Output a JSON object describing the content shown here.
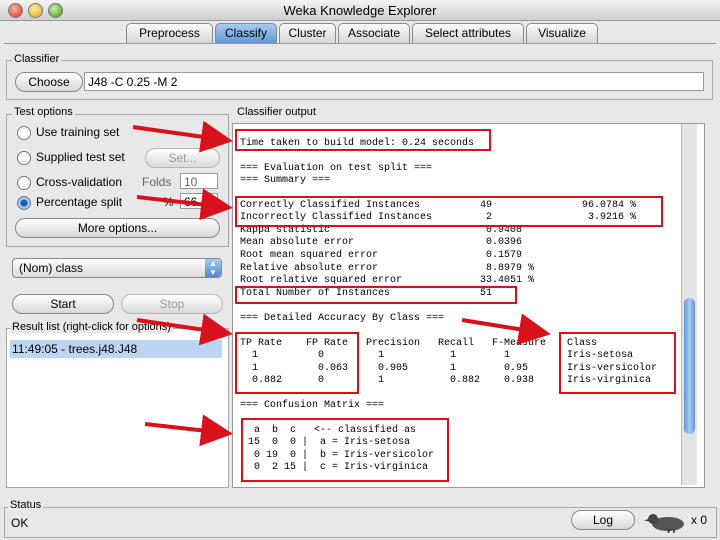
{
  "window": {
    "title": "Weka Knowledge Explorer"
  },
  "tabs": [
    "Preprocess",
    "Classify",
    "Cluster",
    "Associate",
    "Select attributes",
    "Visualize"
  ],
  "classifier": {
    "group_label": "Classifier",
    "choose_label": "Choose",
    "config": "J48 -C 0.25 -M 2"
  },
  "test_options": {
    "group_label": "Test options",
    "use_training_set": "Use training set",
    "supplied_test_set": "Supplied test set",
    "set_button": "Set...",
    "cross_validation": "Cross-validation",
    "folds_label": "Folds",
    "folds_value": "10",
    "percentage_split": "Percentage split",
    "percent_label": "%",
    "percent_value": "66",
    "more_options": "More options..."
  },
  "class_select": "(Nom) class",
  "start_label": "Start",
  "stop_label": "Stop",
  "result_list": {
    "label": "Result list (right-click for options)",
    "items": [
      "11:49:05 - trees.j48.J48"
    ]
  },
  "output": {
    "label": "Classifier output",
    "time_taken": "Time taken to build model: 0.24 seconds",
    "eval_header": "=== Evaluation on test split ===",
    "summary_header": "=== Summary ===",
    "correct": "Correctly Classified Instances          49               96.0784 %",
    "incorrect": "Incorrectly Classified Instances         2                3.9216 %",
    "summary_rows": [
      "Kappa statistic                          0.9408",
      "Mean absolute error                      0.0396",
      "Root mean squared error                  0.1579",
      "Relative absolute error                  8.8979 %",
      "Root relative squared error             33.4051 %"
    ],
    "total": "Total Number of Instances               51",
    "accuracy_header": "=== Detailed Accuracy By Class ===",
    "tp_fp": [
      "TP Rate    FP Rate",
      "  1          0",
      "  1          0.063",
      "  0.882      0"
    ],
    "prec_rec": [
      "Precision   Recall   F-Measure",
      "  1           1        1",
      "  0.905       1        0.95",
      "  1           0.882    0.938"
    ],
    "classes": [
      "Class",
      "Iris-setosa",
      "Iris-versicolor",
      "Iris-virginica"
    ],
    "confusion_header": "=== Confusion Matrix ===",
    "confusion": [
      " a  b  c   <-- classified as",
      "15  0  0 |  a = Iris-setosa",
      " 0 19  0 |  b = Iris-versicolor",
      " 0  2 15 |  c = Iris-virginica"
    ]
  },
  "status": {
    "label": "Status",
    "text": "OK",
    "log_label": "Log",
    "count": "x 0"
  },
  "colors": {
    "annotation": "#d8121c",
    "tab_active": "#5f98d8"
  }
}
